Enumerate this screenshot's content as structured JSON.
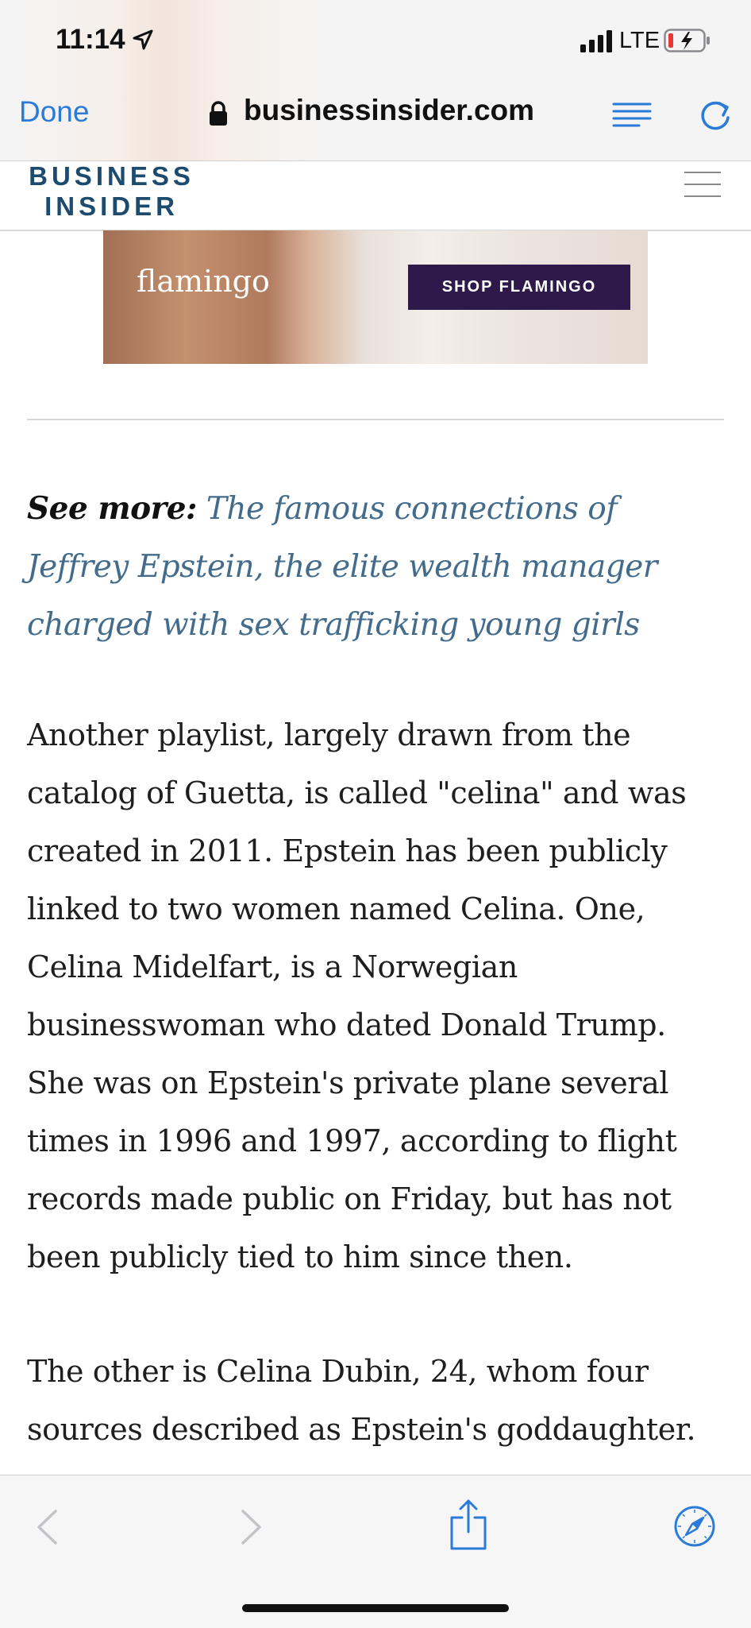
{
  "status_bar": {
    "time": "11:14",
    "network": "LTE",
    "icons": [
      "location-arrow-icon",
      "signal-icon",
      "battery-charging-icon"
    ]
  },
  "browser": {
    "done_label": "Done",
    "url": "businessinsider.com",
    "icons": [
      "lock-icon",
      "reader-mode-icon",
      "reload-icon"
    ],
    "accent_color": "#2a7ad8"
  },
  "site_header": {
    "logo_line1": "BUSINESS",
    "logo_line2": "INSIDER",
    "logo_color": "#1d4b6e",
    "icons": [
      "hamburger-menu-icon"
    ]
  },
  "ad": {
    "brand": "flamingo",
    "cta": "SHOP FLAMINGO"
  },
  "article": {
    "see_more_lead": "See more:",
    "see_more_link": "The famous connections of Jeffrey Epstein, the elite wealth manager charged with sex trafficking young girls",
    "link_color": "#426b8c",
    "paragraph_1": "Another playlist, largely drawn from the catalog of Guetta, is called \"celina\" and was created in 2011. Epstein has been publicly linked to two women named Celina. One, Celina Midelfart, is a Norwegian businesswoman who dated Donald Trump. She was on Epstein's private plane several times in 1996 and 1997, according to flight records made public on Friday, but has not been publicly tied to him since then.",
    "paragraph_2": "The other is Celina Dubin, 24, whom four sources described as Epstein's goddaughter."
  },
  "toolbar": {
    "icons": [
      "back-arrow-icon",
      "forward-arrow-icon",
      "share-icon",
      "compass-icon"
    ]
  }
}
